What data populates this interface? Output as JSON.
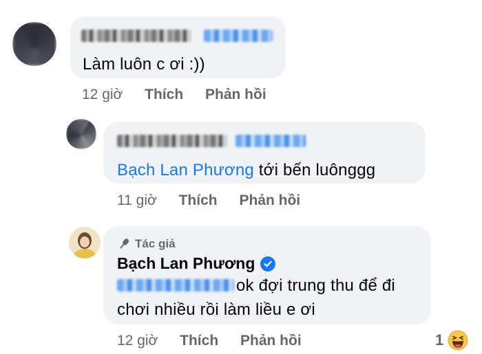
{
  "comments": [
    {
      "text": "Làm luôn c ơi :))",
      "time": "12 giờ",
      "like_label": "Thích",
      "reply_label": "Phản hồi"
    },
    {
      "mention": "Bạch Lan Phương",
      "text": " tới bến luônggg",
      "time": "11 giờ",
      "like_label": "Thích",
      "reply_label": "Phản hồi"
    },
    {
      "author_badge": "Tác giả",
      "author_name": "Bạch Lan Phương",
      "text_line1": "ok đợi trung thu để đi",
      "text_line2": "chơi nhiều rồi làm liều e ơi",
      "time": "12 giờ",
      "like_label": "Thích",
      "reply_label": "Phản hồi",
      "reaction_count": "1",
      "reaction_icon": "haha-emoji-icon"
    }
  ],
  "colors": {
    "bubble": "#f0f2f5",
    "mention": "#1877f2",
    "meta": "#65676b",
    "verified": "#1877f2"
  }
}
